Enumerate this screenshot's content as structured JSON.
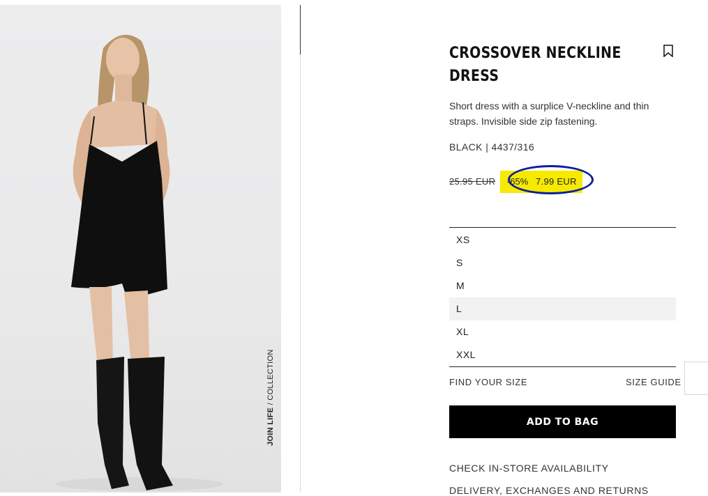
{
  "product": {
    "title": "CROSSOVER NECKLINE DRESS",
    "description": "Short dress with a surplice V-neckline and thin straps. Invisible side zip fastening.",
    "color_ref": "BLACK | 4437/316",
    "price": {
      "original": "25.95 EUR",
      "discount": "-65%",
      "sale": "7.99 EUR",
      "highlight_color": "#f5ea00",
      "annotation_color": "#0a1f9e"
    }
  },
  "image_label": {
    "brand": "JOIN LIFE",
    "rest": " / COLLECTION"
  },
  "sizes": [
    {
      "label": "XS",
      "highlighted": false
    },
    {
      "label": "S",
      "highlighted": false
    },
    {
      "label": "M",
      "highlighted": false
    },
    {
      "label": "L",
      "highlighted": true
    },
    {
      "label": "XL",
      "highlighted": false
    },
    {
      "label": "XXL",
      "highlighted": false
    }
  ],
  "links": {
    "find_size": "FIND YOUR SIZE",
    "size_guide": "SIZE GUIDE",
    "store_availability": "CHECK IN-STORE AVAILABILITY",
    "delivery": "DELIVERY, EXCHANGES AND RETURNS"
  },
  "actions": {
    "add_to_bag": "ADD TO BAG"
  },
  "icons": {
    "bookmark": "bookmark-icon"
  }
}
